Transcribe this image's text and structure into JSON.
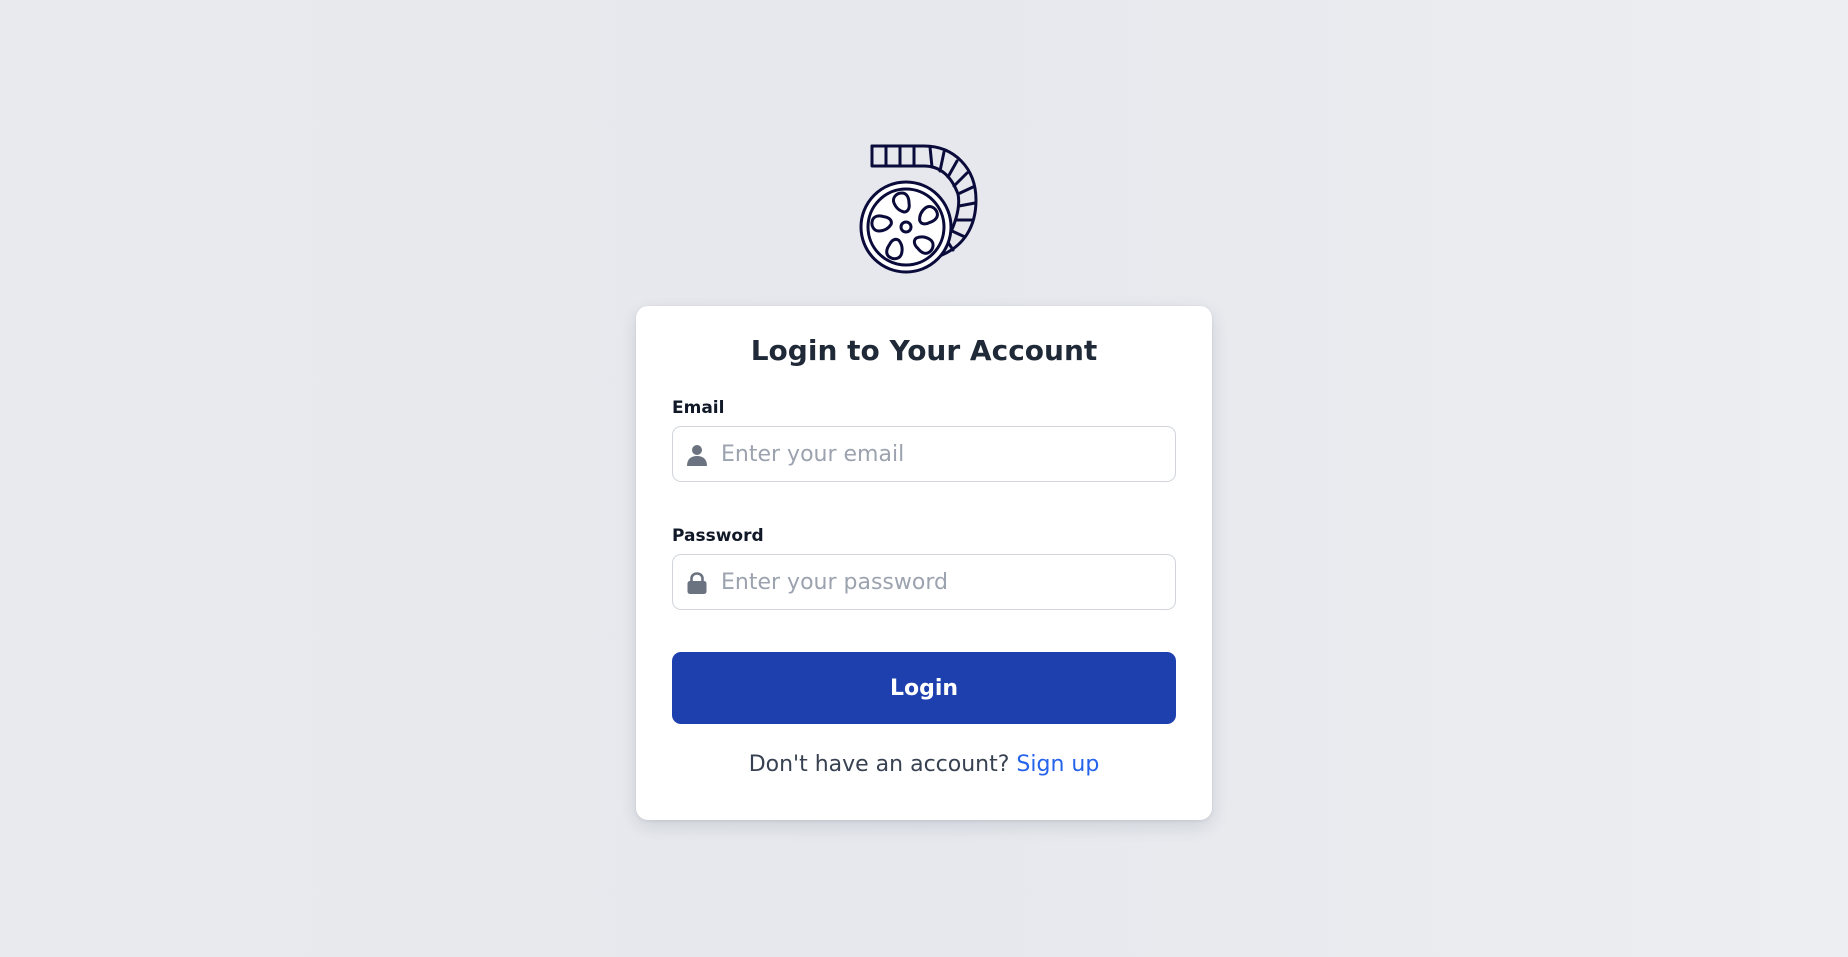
{
  "logo": {
    "icon": "film-reel-icon",
    "color": "#0b0b3b"
  },
  "card": {
    "title": "Login to Your Account",
    "email": {
      "label": "Email",
      "placeholder": "Enter your email",
      "value": "",
      "icon": "user-icon"
    },
    "password": {
      "label": "Password",
      "placeholder": "Enter your password",
      "value": "",
      "icon": "lock-icon"
    },
    "login_button": "Login",
    "signup_prompt": "Don't have an account?",
    "signup_link": "Sign up"
  },
  "colors": {
    "primary": "#1e40af",
    "link": "#2563eb",
    "heading": "#1f2937",
    "icon_gray": "#6b7280"
  }
}
